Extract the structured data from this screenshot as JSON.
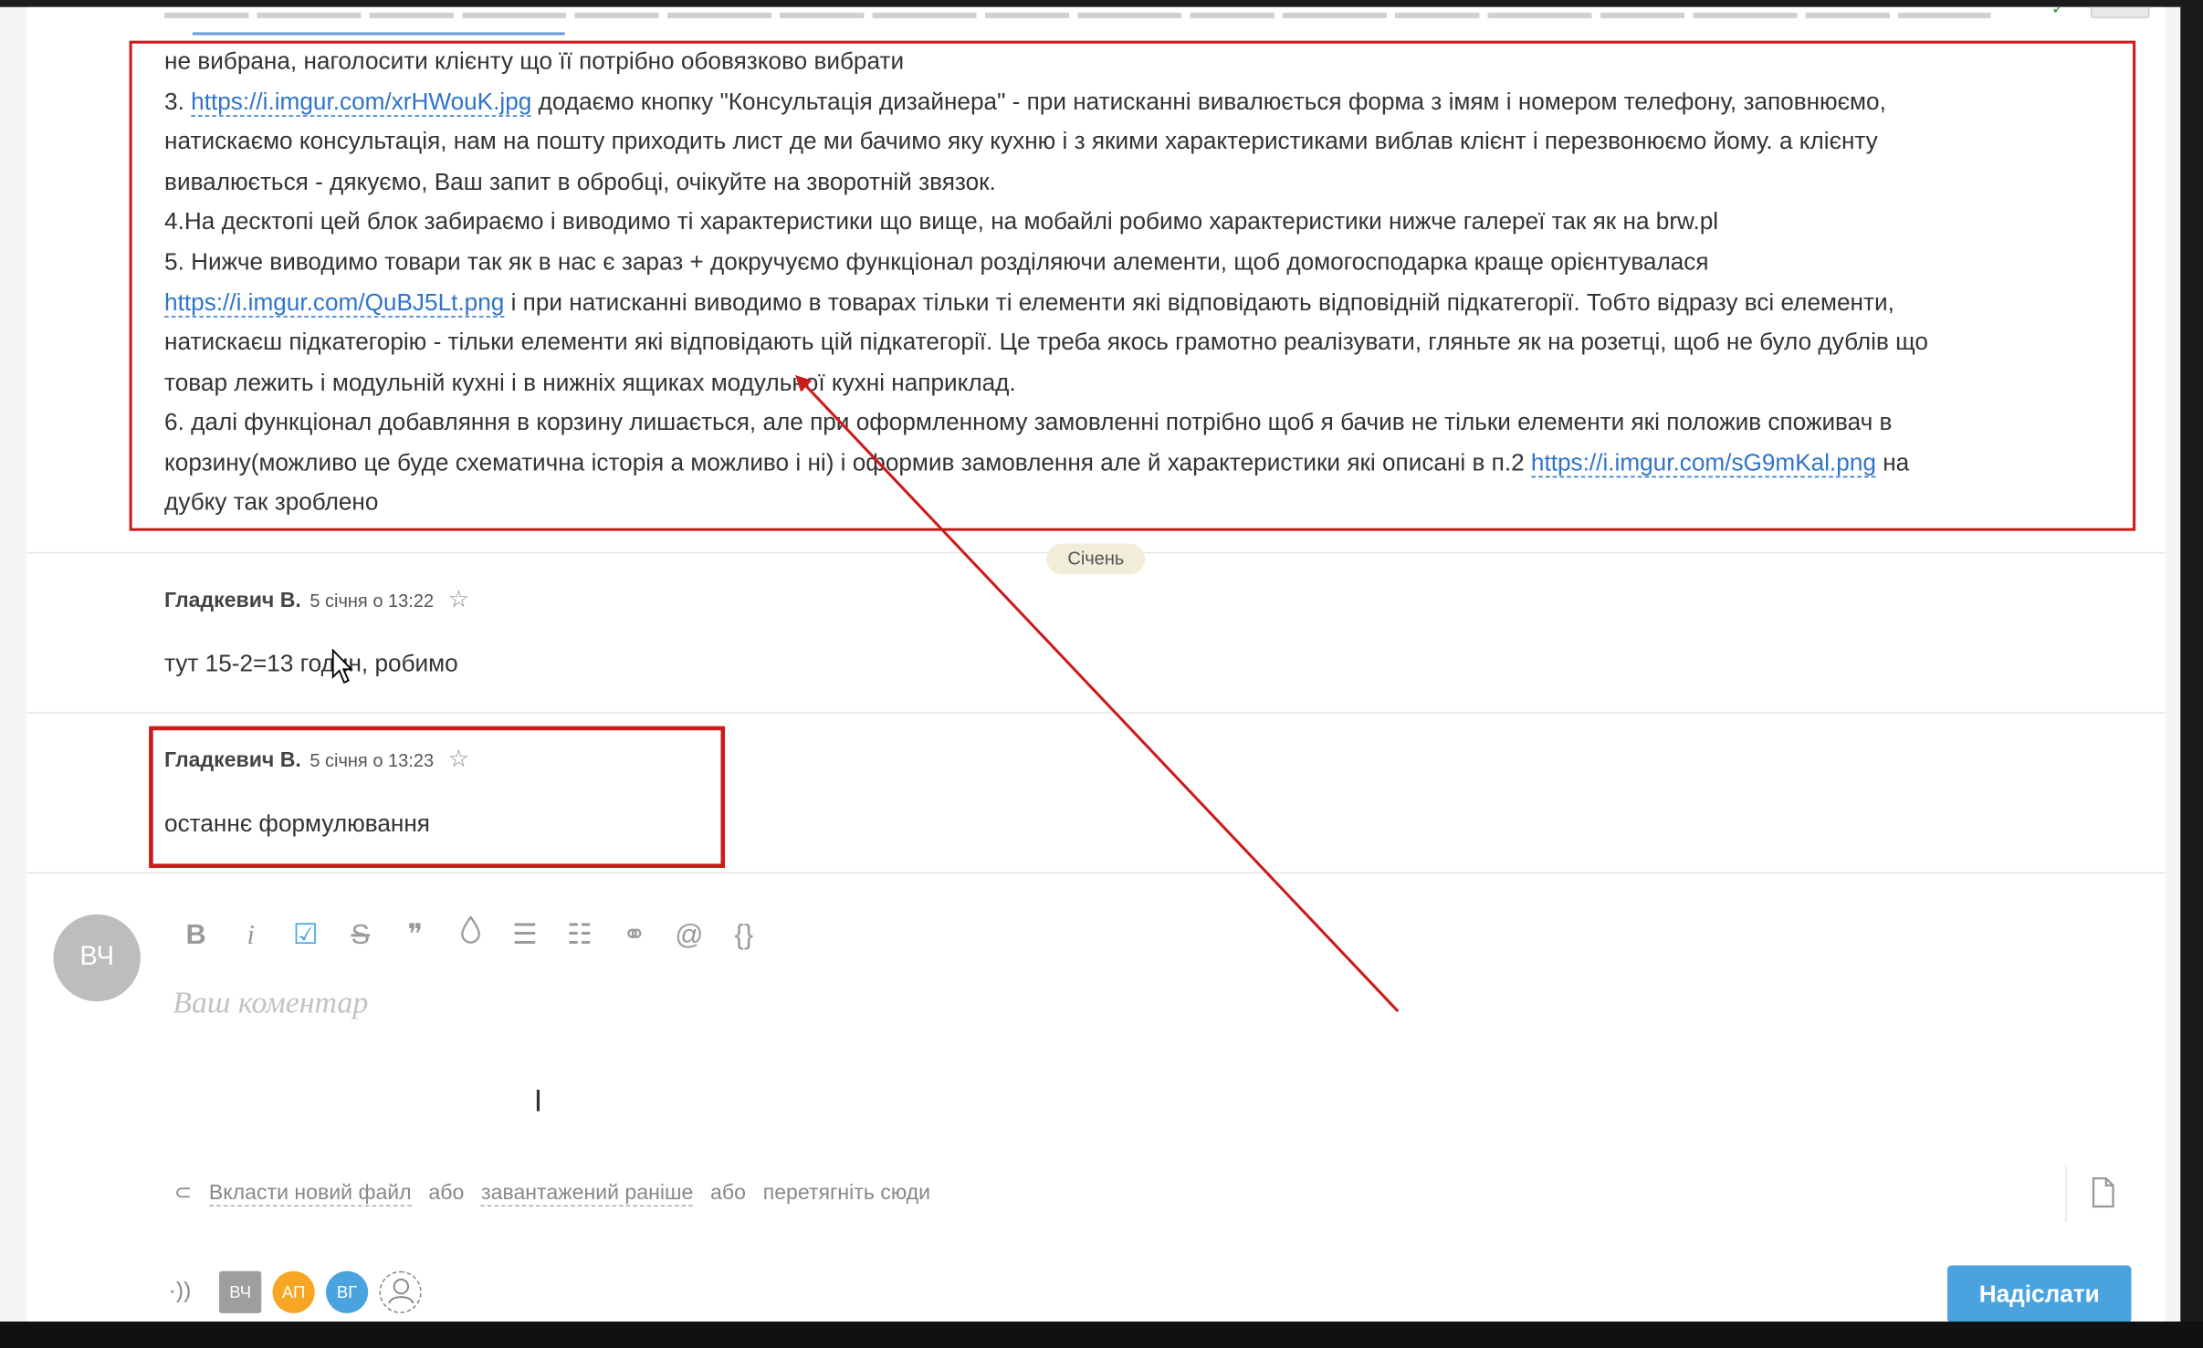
{
  "message": {
    "line1": "не вибрана, наголосити клієнту що її потрібно обовязково вибрати",
    "line2_prefix": "3. ",
    "line2_link": "https://i.imgur.com/xrHWouK.jpg",
    "line2_suffix": " додаємо кнопку \"Консультація дизайнера\" - при натисканні вивалюється форма з імям і номером телефону, заповнюємо,",
    "line3": "натискаємо консультація, нам на пошту приходить лист де ми бачимо яку кухню і з якими характеристиками виблав клієнт і перезвонюємо йому. а клієнту",
    "line4": "вивалюється - дякуємо, Ваш запит в обробці, очікуйте на зворотній звязок.",
    "line5": "4.На десктопі цей блок забираємо і виводимо ті характеристики що вище, на мобайлі робимо характеристики нижче галереї так як на brw.pl",
    "line6": "5. Нижче виводимо товари так як в нас є зараз + докручуємо функціонал розділяючи алементи, щоб домогосподарка краще орієнтувалася",
    "line7_link": "https://i.imgur.com/QuBJ5Lt.png",
    "line7_suffix": " і при натисканні виводимо в товарах тільки ті елементи які відповідають відповідній підкатегорії. Тобто відразу всі елементи,",
    "line8": "натискаєш підкатегорію - тільки елементи які відповідають цій підкатегорії. Це треба якось грамотно реалізувати, гляньте як на розетці, щоб не було дублів що",
    "line9": "товар лежить і модульній кухні і в нижніх ящиках модульної кухні наприклад.",
    "line10": "6. далі функціонал добавляння в корзину лишається, але при оформленному замовленні потрібно щоб я бачив не тільки елементи які положив споживач в",
    "line11_prefix": "корзину(можливо це буде схематична історія а можливо і ні) і оформив замовлення але й характеристики які описані в п.2 ",
    "line11_link": "https://i.imgur.com/sG9mKal.png",
    "line11_suffix": " на",
    "line12": "дубку так зроблено"
  },
  "date_separator": "Січень",
  "comments": [
    {
      "author": "Гладкевич В.",
      "time": "5 січня о 13:22",
      "text": "тут 15-2=13 годин, робимо"
    },
    {
      "author": "Гладкевич В.",
      "time": "5 січня о 13:23",
      "text": "останнє формулювання"
    }
  ],
  "editor": {
    "avatar_initials": "ВЧ",
    "placeholder": "Ваш коментар",
    "toolbar_icons": [
      "bold-icon",
      "italic-icon",
      "checkbox-icon",
      "strikethrough-icon",
      "quote-icon",
      "color-drop-icon",
      "bullet-list-icon",
      "numbered-list-icon",
      "link-icon",
      "mention-icon",
      "code-braces-icon"
    ],
    "toolbar_glyphs": [
      "B",
      "i",
      "☑",
      "S",
      "❞",
      "💧",
      "☰",
      "☷",
      "⚭",
      "@",
      "{}"
    ]
  },
  "attach": {
    "new_file": "Вкласти новий файл",
    "or1": "або",
    "uploaded": "завантажений раніше",
    "or2": "або",
    "drag": "перетягніть сюди"
  },
  "participants": [
    "ВЧ",
    "АП",
    "ВГ"
  ],
  "send_label": "Надіслати",
  "colors": {
    "accent": "#4aa3df",
    "link": "#2e74c9",
    "annotation_red": "#cc1b1b",
    "orange_avatar": "#f6a623"
  }
}
